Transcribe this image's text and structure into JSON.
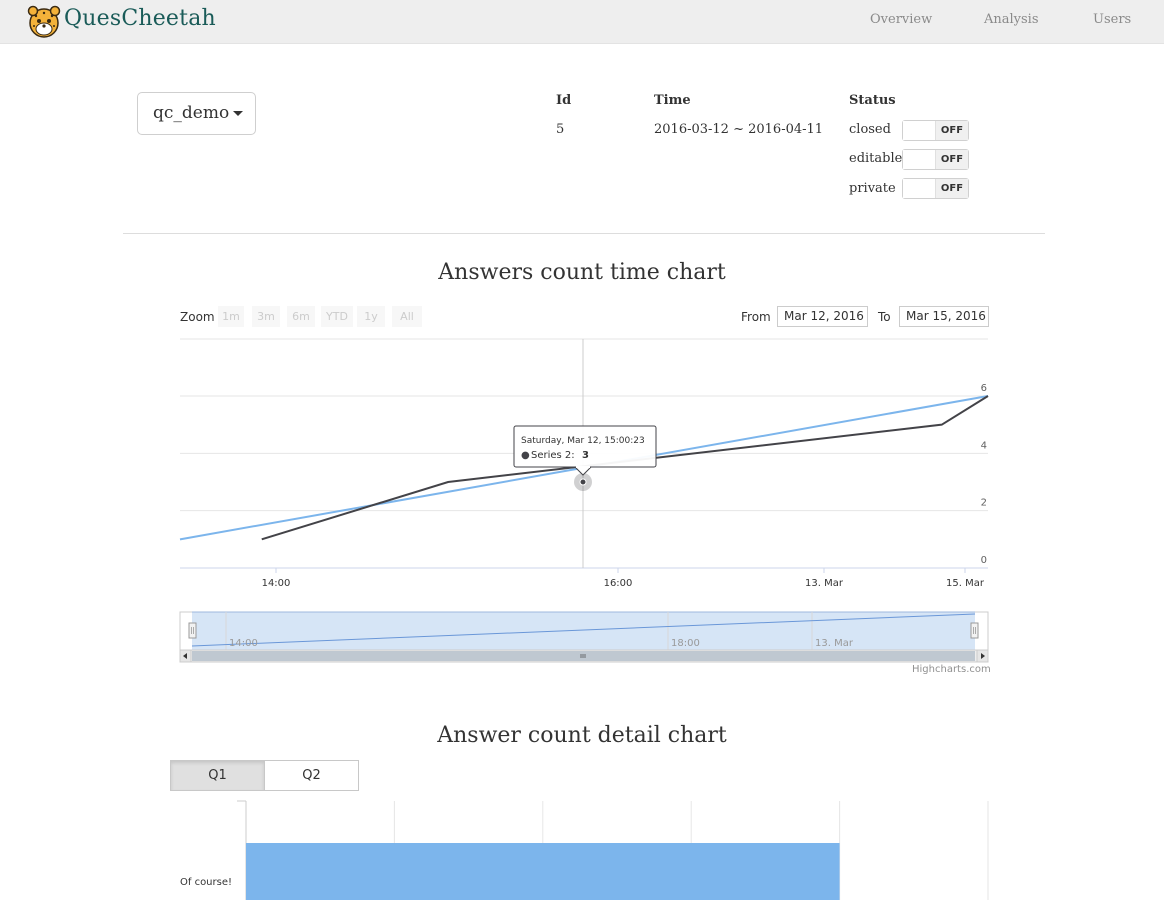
{
  "header": {
    "brand": "QuesCheetah",
    "nav": [
      "Overview",
      "Analysis",
      "Users"
    ]
  },
  "survey": {
    "selected": "qc_demo",
    "id_label": "Id",
    "id_value": "5",
    "time_label": "Time",
    "time_value": "2016-03-12 ~ 2016-04-11",
    "status_label": "Status",
    "statuses": [
      {
        "label": "closed",
        "value": "OFF"
      },
      {
        "label": "editable",
        "value": "OFF"
      },
      {
        "label": "private",
        "value": "OFF"
      }
    ]
  },
  "time_chart": {
    "title": "Answers count time chart",
    "zoom_label": "Zoom",
    "zoom_buttons": [
      "1m",
      "3m",
      "6m",
      "YTD",
      "1y",
      "All"
    ],
    "from_label": "From",
    "from_value": "Mar 12, 2016",
    "to_label": "To",
    "to_value": "Mar 15, 2016",
    "tooltip_date": "Saturday, Mar 12, 15:00:23",
    "tooltip_series_label": "Series 2:",
    "tooltip_series_value": "3",
    "x_ticks": [
      "14:00",
      "16:00",
      "13. Mar",
      "15. Mar"
    ],
    "y_ticks": [
      "0",
      "2",
      "4",
      "6"
    ],
    "navigator_ticks": [
      "14:00",
      "18:00",
      "13. Mar"
    ],
    "credits": "Highcharts.com",
    "series_colors": {
      "series1": "#7cb5ec",
      "series2": "#434348"
    }
  },
  "detail_chart": {
    "title": "Answer count detail chart",
    "tabs": [
      "Q1",
      "Q2"
    ],
    "active_tab": "Q1",
    "bar_label": "Of course!",
    "bar_color": "#7cb5ec"
  },
  "chart_data": [
    {
      "type": "line",
      "title": "Answers count time chart",
      "ylim": [
        0,
        6
      ],
      "x_range": [
        "2016-03-12 13:00",
        "2016-03-15 00:00"
      ],
      "series": [
        {
          "name": "",
          "x": [
            "2016-03-12 13:00",
            "2016-03-15 00:00"
          ],
          "values": [
            1.0,
            6
          ]
        },
        {
          "name": "Series 2",
          "x": [
            "2016-03-12 13:55",
            "2016-03-12 15:00:23",
            "2016-03-14 17:00",
            "2016-03-15 00:00"
          ],
          "values": [
            1,
            3,
            5,
            6
          ]
        }
      ],
      "legend": "none",
      "grid": true
    },
    {
      "type": "bar",
      "title": "Answer count detail chart",
      "categories": [
        "Of course!"
      ],
      "values": [
        4
      ],
      "xlim": [
        0,
        5
      ]
    }
  ]
}
